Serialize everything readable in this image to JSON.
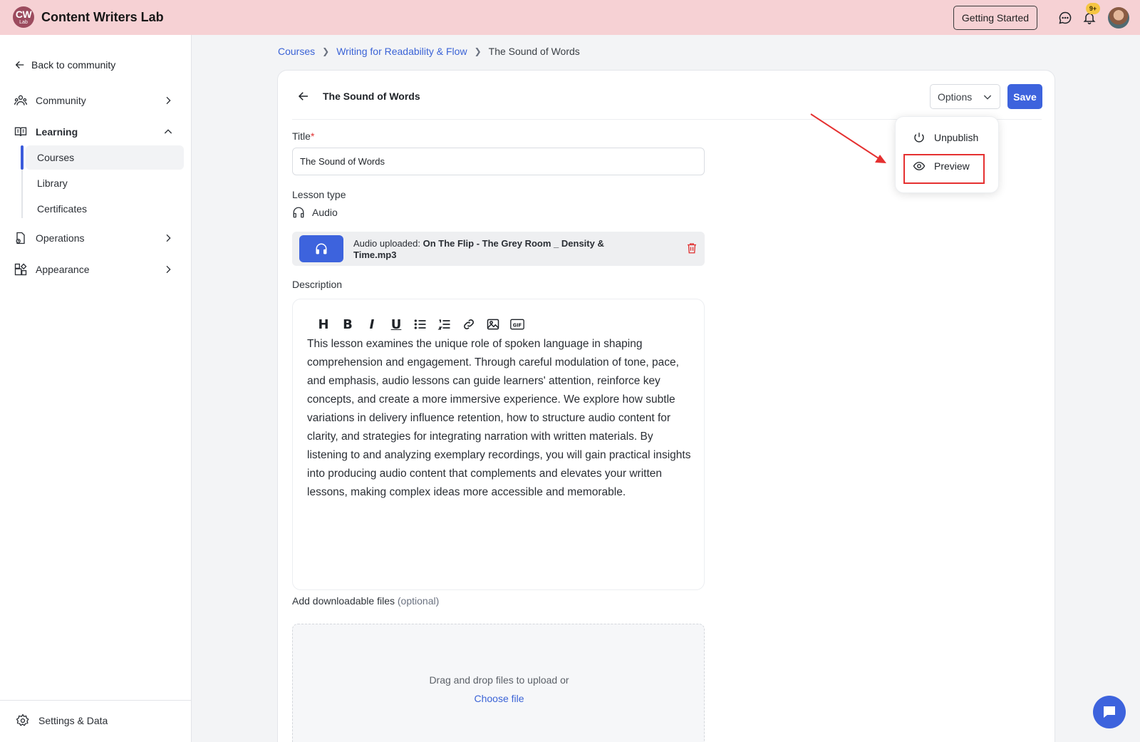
{
  "app": {
    "logo_text_top": "CW",
    "logo_text_bottom": "Lab",
    "title": "Content Writers Lab",
    "getting_started": "Getting Started",
    "notification_badge": "9+"
  },
  "sidebar": {
    "back_label": "Back to community",
    "items": [
      {
        "label": "Community",
        "icon": "community-icon"
      },
      {
        "label": "Learning",
        "icon": "book-icon"
      },
      {
        "label": "Operations",
        "icon": "operations-icon"
      },
      {
        "label": "Appearance",
        "icon": "appearance-icon"
      }
    ],
    "sub_items": [
      {
        "label": "Courses",
        "active": true
      },
      {
        "label": "Library"
      },
      {
        "label": "Certificates"
      }
    ],
    "settings_label": "Settings & Data"
  },
  "breadcrumb": {
    "courses": "Courses",
    "course": "Writing for Readability & Flow",
    "current": "The Sound of Words"
  },
  "editor": {
    "header_title": "The Sound of Words",
    "options_label": "Options",
    "save_label": "Save",
    "title_label": "Title",
    "title_required": "*",
    "title_value": "The Sound of Words",
    "lesson_type_label": "Lesson type",
    "lesson_type_value": "Audio",
    "audio_prefix": "Audio uploaded: ",
    "audio_filename": "On The Flip - The Grey Room _ Density & Time.mp3",
    "description_label": "Description",
    "toolbar": {
      "heading": "H",
      "bold": "B",
      "italic": "I",
      "underline": "U"
    },
    "description_text": "This lesson examines the unique role of spoken language in shaping comprehension and engagement. Through careful modulation of tone, pace, and emphasis, audio lessons can guide learners' attention, reinforce key concepts, and create a more immersive experience. We explore how subtle variations in delivery influence retention, how to structure audio content for clarity, and strategies for integrating narration with written materials. By listening to and analyzing exemplary recordings, you will gain practical insights into producing audio content that complements and elevates your written lessons, making complex ideas more accessible and memorable.",
    "files_label": "Add downloadable files",
    "files_optional": "(optional)",
    "upload_text": "Drag and drop files to upload or",
    "choose_file": "Choose file"
  },
  "dropdown": {
    "items": [
      {
        "label": "Unpublish",
        "icon": "power-icon"
      },
      {
        "label": "Preview",
        "icon": "eye-icon"
      }
    ]
  },
  "colors": {
    "topbar": "#f6d1d4",
    "accent": "#3d63dd",
    "link": "#3b63d6",
    "annotation": "#e53030"
  }
}
